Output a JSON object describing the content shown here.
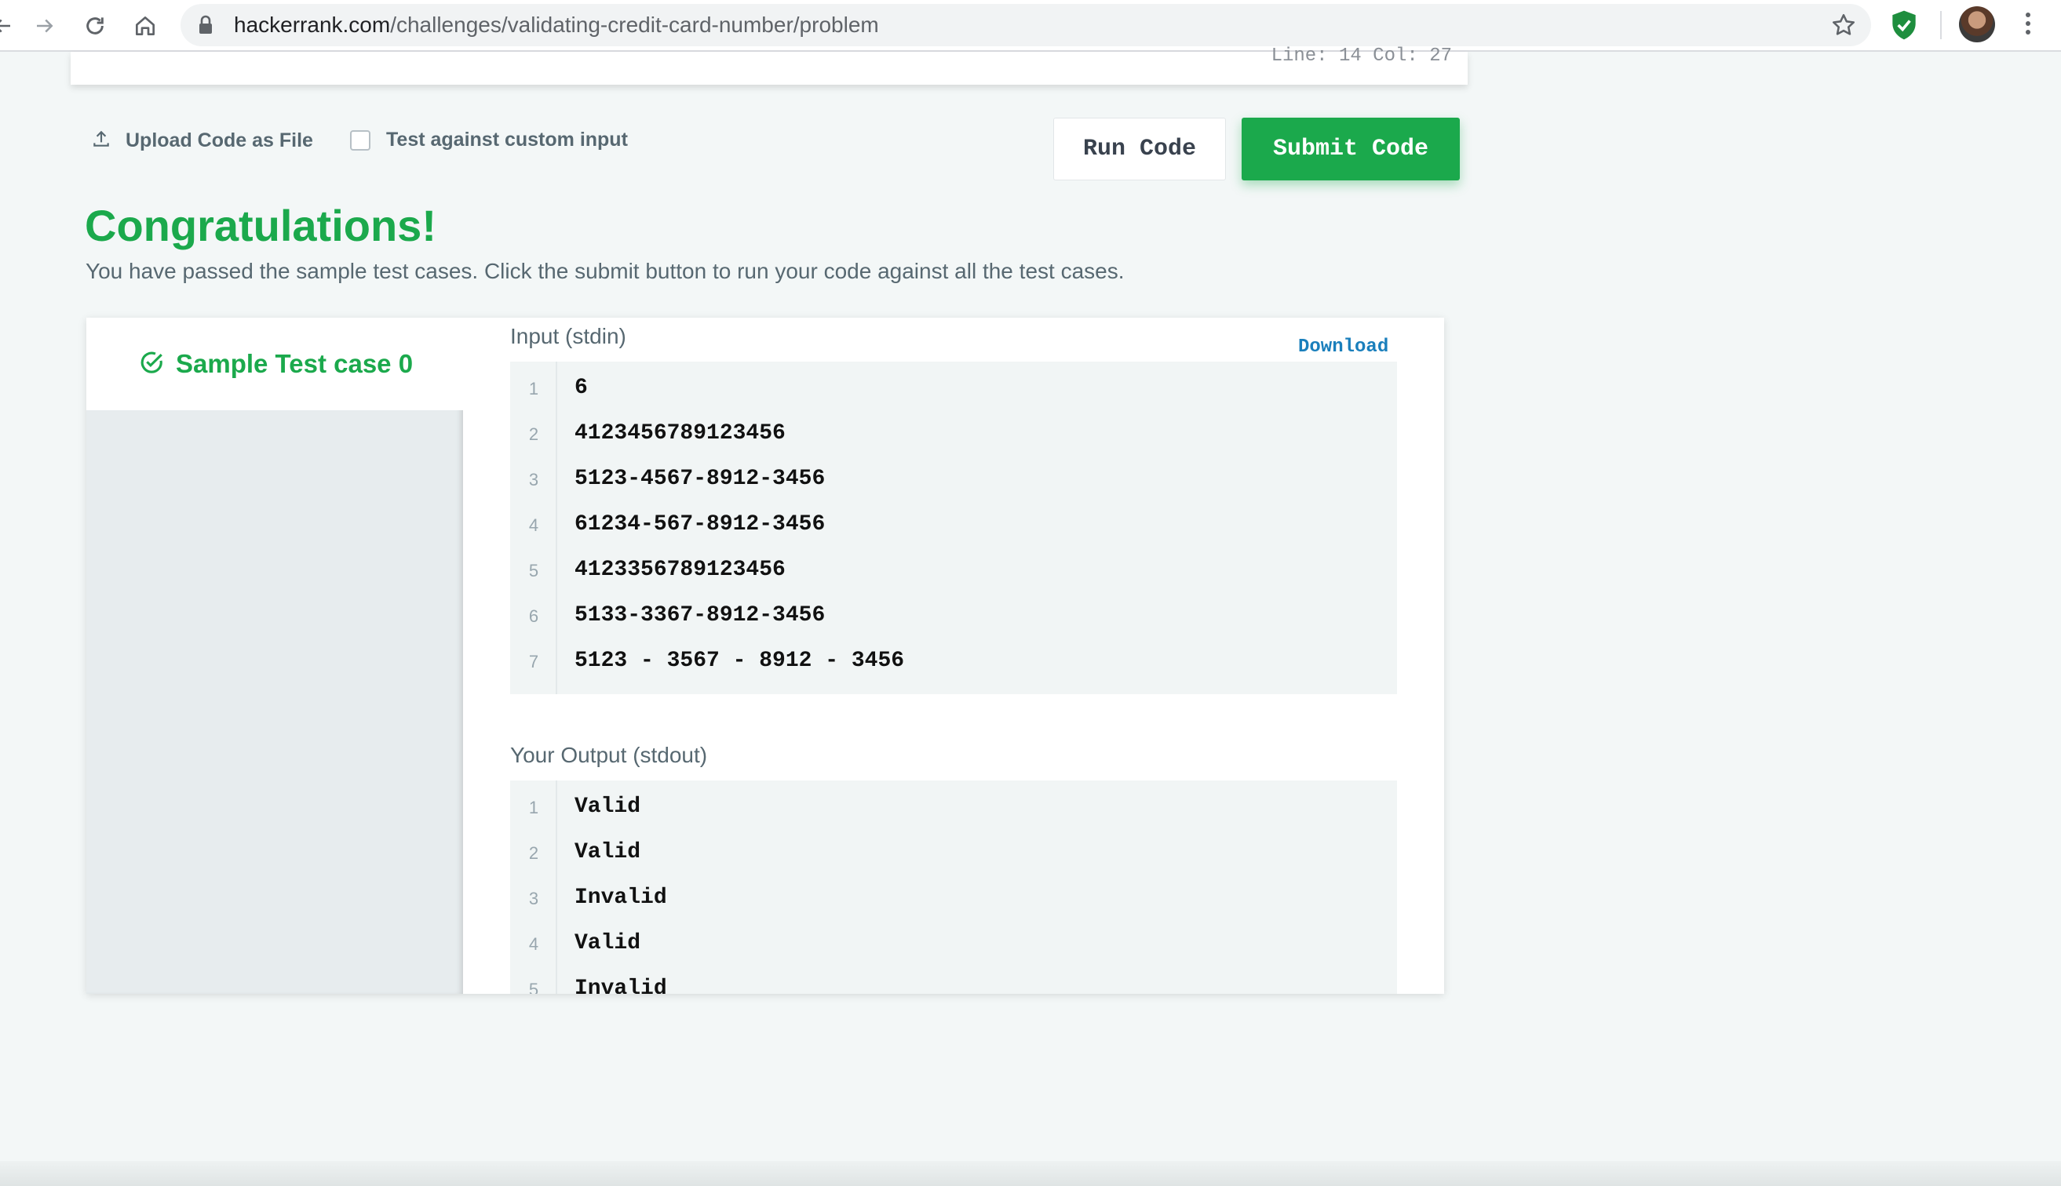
{
  "browser": {
    "url_domain": "hackerrank.com",
    "url_path": "/challenges/validating-credit-card-number/problem",
    "icons": [
      "back-arrow-icon",
      "forward-arrow-icon",
      "reload-icon",
      "home-icon",
      "lock-icon",
      "star-icon",
      "extension-shield-icon",
      "profile-avatar",
      "more-menu-icon"
    ]
  },
  "editor": {
    "cursor_position": "Line: 14 Col: 27"
  },
  "actions": {
    "upload_label": "Upload Code as File",
    "custom_input_label": "Test against custom input",
    "custom_input_checked": false,
    "run_label": "Run Code",
    "submit_label": "Submit Code"
  },
  "result": {
    "title": "Congratulations!",
    "message": "You have passed the sample test cases. Click the submit button to run your code against all the test cases."
  },
  "test_cases": [
    {
      "label": "Sample Test case 0",
      "status": "passed",
      "active": true
    }
  ],
  "input": {
    "title": "Input (stdin)",
    "download_label": "Download",
    "lines": [
      {
        "n": "1",
        "text": "6"
      },
      {
        "n": "2",
        "text": "4123456789123456"
      },
      {
        "n": "3",
        "text": "5123-4567-8912-3456"
      },
      {
        "n": "4",
        "text": "61234-567-8912-3456"
      },
      {
        "n": "5",
        "text": "4123356789123456"
      },
      {
        "n": "6",
        "text": "5133-3367-8912-3456"
      },
      {
        "n": "7",
        "text": "5123 - 3567 - 8912 - 3456"
      }
    ]
  },
  "output": {
    "title": "Your Output (stdout)",
    "lines": [
      {
        "n": "1",
        "text": "Valid"
      },
      {
        "n": "2",
        "text": "Valid"
      },
      {
        "n": "3",
        "text": "Invalid"
      },
      {
        "n": "4",
        "text": "Valid"
      },
      {
        "n": "5",
        "text": "Invalid"
      }
    ]
  },
  "colors": {
    "success": "#1ba94c",
    "link": "#1a7fbc",
    "page_bg": "#f3f7f7"
  }
}
